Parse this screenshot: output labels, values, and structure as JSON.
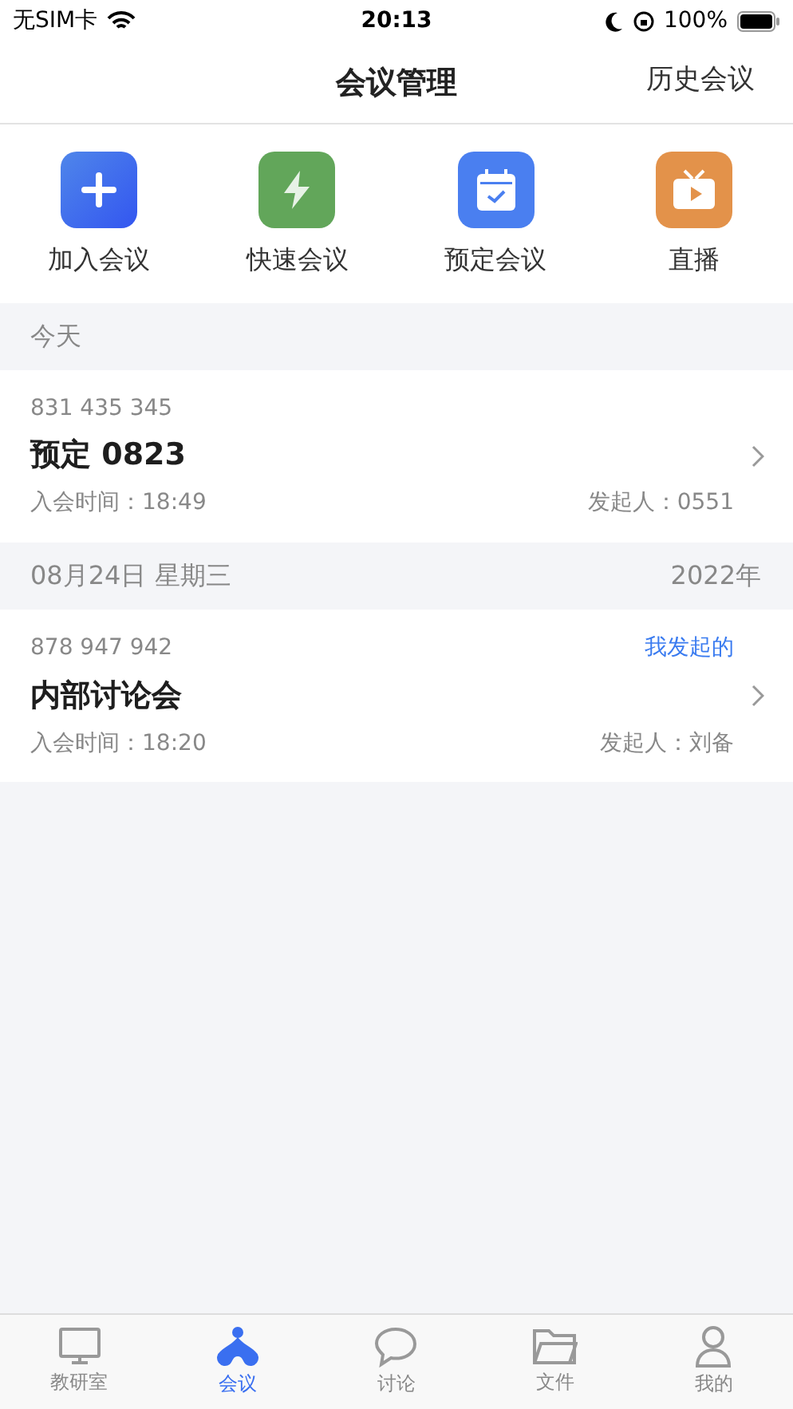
{
  "status_bar": {
    "carrier": "无SIM卡",
    "time": "20:13",
    "battery": "100%"
  },
  "nav": {
    "title": "会议管理",
    "action": "历史会议"
  },
  "actions": [
    {
      "kind": "join",
      "label": "加入会议"
    },
    {
      "kind": "quick",
      "label": "快速会议"
    },
    {
      "kind": "schedule",
      "label": "预定会议"
    },
    {
      "kind": "live",
      "label": "直播"
    }
  ],
  "sections": [
    {
      "label": "今天",
      "meetings": [
        {
          "number": "831 435 345",
          "title": "预定 0823",
          "join_time": "入会时间：18:49",
          "initiator": "发起人：0551"
        }
      ]
    },
    {
      "label": "08月24日 星期三",
      "year": "2022年",
      "meetings": [
        {
          "number": "878 947 942",
          "badge": "我发起的",
          "title": "内部讨论会",
          "join_time": "入会时间：18:20",
          "initiator": "发起人：刘备"
        }
      ]
    }
  ],
  "tab_bar": [
    {
      "kind": "monitor",
      "label": "教研室",
      "selected": false
    },
    {
      "kind": "meeting",
      "label": "会议",
      "selected": true
    },
    {
      "kind": "chat",
      "label": "讨论",
      "selected": false
    },
    {
      "kind": "folder",
      "label": "文件",
      "selected": false
    },
    {
      "kind": "user",
      "label": "我的",
      "selected": false
    }
  ]
}
